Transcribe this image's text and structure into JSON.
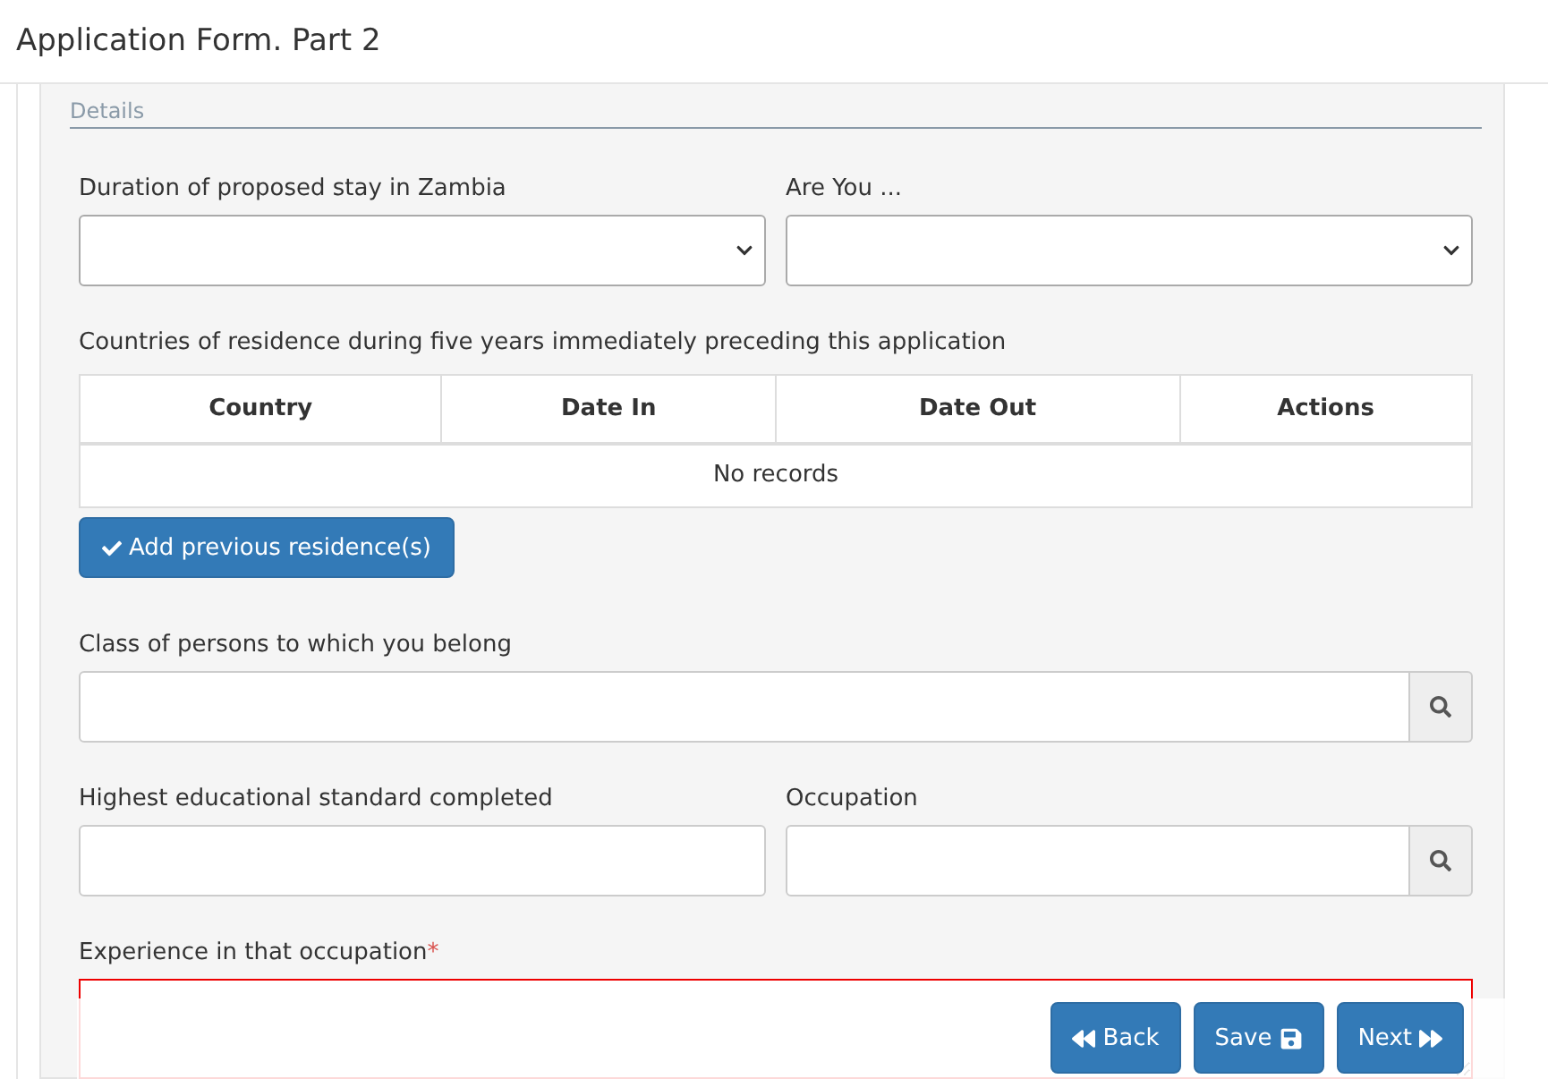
{
  "window": {
    "title": "Application Form. Part 2"
  },
  "section": {
    "legend": "Details"
  },
  "duration": {
    "label": "Duration of proposed stay in Zambia"
  },
  "are_you": {
    "label": "Are You ..."
  },
  "residences": {
    "label": "Countries of residence during five years immediately preceding this application",
    "columns": [
      "Country",
      "Date In",
      "Date Out",
      "Actions"
    ],
    "empty": "No records",
    "add_button": "Add previous residence(s)"
  },
  "class_of_persons": {
    "label": "Class of persons to which you belong"
  },
  "education": {
    "label": "Highest educational standard completed"
  },
  "occupation": {
    "label": "Occupation"
  },
  "experience": {
    "label": "Experience in that occupation",
    "required_mark": "*",
    "invalid": true
  },
  "footer": {
    "buttons": [
      {
        "kind": "back",
        "label": "Back"
      },
      {
        "kind": "save",
        "label": "Save"
      },
      {
        "kind": "next",
        "label": "Next"
      }
    ]
  }
}
